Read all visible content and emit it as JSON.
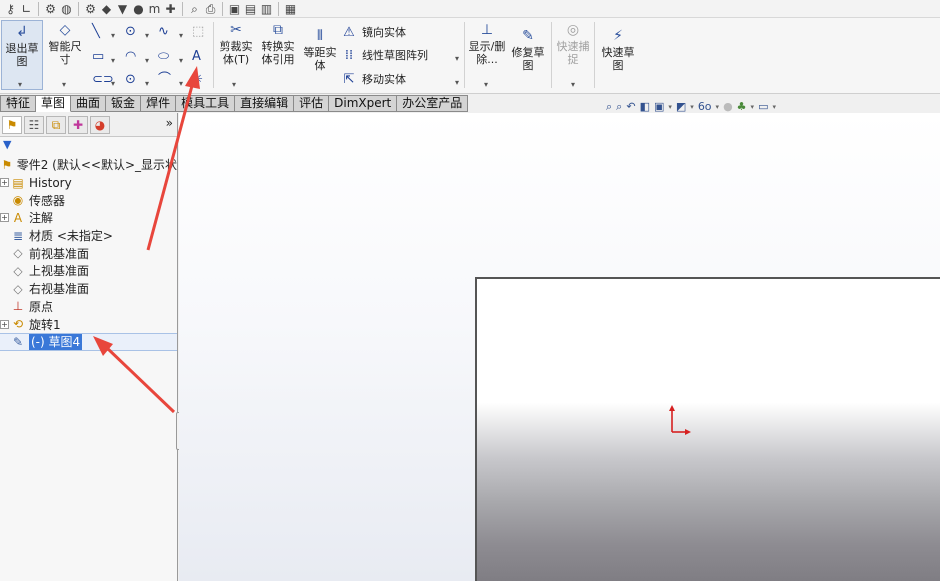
{
  "quick_access": {
    "icons": [
      "key-icon",
      "sketch-corner-icon",
      "assembly-icon",
      "globe-icon",
      "gear-icon",
      "box-icon",
      "bowl-icon",
      "pin-icon",
      "mmm-icon",
      "cross-icon",
      "magnifier-icon",
      "print-icon",
      "save-icon",
      "file-icon",
      "book-icon"
    ]
  },
  "ribbon": {
    "exit_sketch": "退出草图",
    "smart_dimension": "智能尺寸",
    "trim_entities": "剪裁实体(T)",
    "convert_entities": "转换实体引用",
    "offset_entities": "等距实体",
    "mirror_entities": "镜向实体",
    "linear_pattern": "线性草图阵列",
    "move_entities": "移动实体",
    "display_delete": "显示/删除...",
    "repair_sketch": "修复草图",
    "quick_snaps": "快速捕捉",
    "rapid_sketch": "快速草图"
  },
  "tabs": [
    "特征",
    "草图",
    "曲面",
    "钣金",
    "焊件",
    "模具工具",
    "直接编辑",
    "评估",
    "DimXpert",
    "办公室产品"
  ],
  "active_tab_index": 1,
  "panel": {
    "expand_symbol": "»",
    "filter_icon": "filter-icon",
    "tree": [
      {
        "label": "零件2 (默认<<默认>_显示状",
        "icon": "part-icon",
        "expandable": false
      },
      {
        "label": "History",
        "icon": "history-icon",
        "expandable": true
      },
      {
        "label": "传感器",
        "icon": "sensor-icon",
        "expandable": false
      },
      {
        "label": "注解",
        "icon": "annotation-icon",
        "expandable": true
      },
      {
        "label": "材质 <未指定>",
        "icon": "material-icon",
        "expandable": false
      },
      {
        "label": "前视基准面",
        "icon": "plane-icon",
        "expandable": false
      },
      {
        "label": "上视基准面",
        "icon": "plane-icon",
        "expandable": false
      },
      {
        "label": "右视基准面",
        "icon": "plane-icon",
        "expandable": false
      },
      {
        "label": "原点",
        "icon": "origin-icon",
        "expandable": false
      },
      {
        "label": "旋转1",
        "icon": "revolve-icon",
        "expandable": true
      },
      {
        "label": "(-) 草图4",
        "icon": "sketch-icon",
        "expandable": false,
        "selected": true
      }
    ]
  },
  "colors": {
    "accent": "#3a78d8",
    "annotation_arrow": "#e8463c"
  }
}
